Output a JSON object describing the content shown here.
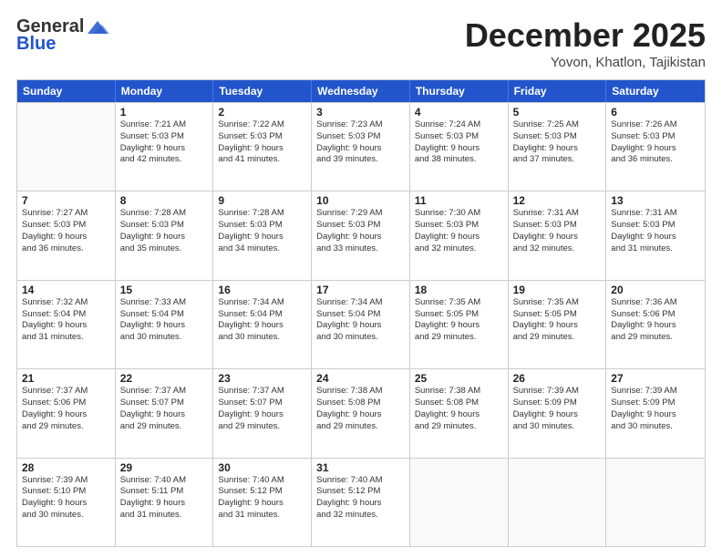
{
  "header": {
    "logo_general": "General",
    "logo_blue": "Blue",
    "month_title": "December 2025",
    "location": "Yovon, Khatlon, Tajikistan"
  },
  "weekdays": [
    "Sunday",
    "Monday",
    "Tuesday",
    "Wednesday",
    "Thursday",
    "Friday",
    "Saturday"
  ],
  "rows": [
    [
      {
        "day": "",
        "text": ""
      },
      {
        "day": "1",
        "text": "Sunrise: 7:21 AM\nSunset: 5:03 PM\nDaylight: 9 hours\nand 42 minutes."
      },
      {
        "day": "2",
        "text": "Sunrise: 7:22 AM\nSunset: 5:03 PM\nDaylight: 9 hours\nand 41 minutes."
      },
      {
        "day": "3",
        "text": "Sunrise: 7:23 AM\nSunset: 5:03 PM\nDaylight: 9 hours\nand 39 minutes."
      },
      {
        "day": "4",
        "text": "Sunrise: 7:24 AM\nSunset: 5:03 PM\nDaylight: 9 hours\nand 38 minutes."
      },
      {
        "day": "5",
        "text": "Sunrise: 7:25 AM\nSunset: 5:03 PM\nDaylight: 9 hours\nand 37 minutes."
      },
      {
        "day": "6",
        "text": "Sunrise: 7:26 AM\nSunset: 5:03 PM\nDaylight: 9 hours\nand 36 minutes."
      }
    ],
    [
      {
        "day": "7",
        "text": "Sunrise: 7:27 AM\nSunset: 5:03 PM\nDaylight: 9 hours\nand 36 minutes."
      },
      {
        "day": "8",
        "text": "Sunrise: 7:28 AM\nSunset: 5:03 PM\nDaylight: 9 hours\nand 35 minutes."
      },
      {
        "day": "9",
        "text": "Sunrise: 7:28 AM\nSunset: 5:03 PM\nDaylight: 9 hours\nand 34 minutes."
      },
      {
        "day": "10",
        "text": "Sunrise: 7:29 AM\nSunset: 5:03 PM\nDaylight: 9 hours\nand 33 minutes."
      },
      {
        "day": "11",
        "text": "Sunrise: 7:30 AM\nSunset: 5:03 PM\nDaylight: 9 hours\nand 32 minutes."
      },
      {
        "day": "12",
        "text": "Sunrise: 7:31 AM\nSunset: 5:03 PM\nDaylight: 9 hours\nand 32 minutes."
      },
      {
        "day": "13",
        "text": "Sunrise: 7:31 AM\nSunset: 5:03 PM\nDaylight: 9 hours\nand 31 minutes."
      }
    ],
    [
      {
        "day": "14",
        "text": "Sunrise: 7:32 AM\nSunset: 5:04 PM\nDaylight: 9 hours\nand 31 minutes."
      },
      {
        "day": "15",
        "text": "Sunrise: 7:33 AM\nSunset: 5:04 PM\nDaylight: 9 hours\nand 30 minutes."
      },
      {
        "day": "16",
        "text": "Sunrise: 7:34 AM\nSunset: 5:04 PM\nDaylight: 9 hours\nand 30 minutes."
      },
      {
        "day": "17",
        "text": "Sunrise: 7:34 AM\nSunset: 5:04 PM\nDaylight: 9 hours\nand 30 minutes."
      },
      {
        "day": "18",
        "text": "Sunrise: 7:35 AM\nSunset: 5:05 PM\nDaylight: 9 hours\nand 29 minutes."
      },
      {
        "day": "19",
        "text": "Sunrise: 7:35 AM\nSunset: 5:05 PM\nDaylight: 9 hours\nand 29 minutes."
      },
      {
        "day": "20",
        "text": "Sunrise: 7:36 AM\nSunset: 5:06 PM\nDaylight: 9 hours\nand 29 minutes."
      }
    ],
    [
      {
        "day": "21",
        "text": "Sunrise: 7:37 AM\nSunset: 5:06 PM\nDaylight: 9 hours\nand 29 minutes."
      },
      {
        "day": "22",
        "text": "Sunrise: 7:37 AM\nSunset: 5:07 PM\nDaylight: 9 hours\nand 29 minutes."
      },
      {
        "day": "23",
        "text": "Sunrise: 7:37 AM\nSunset: 5:07 PM\nDaylight: 9 hours\nand 29 minutes."
      },
      {
        "day": "24",
        "text": "Sunrise: 7:38 AM\nSunset: 5:08 PM\nDaylight: 9 hours\nand 29 minutes."
      },
      {
        "day": "25",
        "text": "Sunrise: 7:38 AM\nSunset: 5:08 PM\nDaylight: 9 hours\nand 29 minutes."
      },
      {
        "day": "26",
        "text": "Sunrise: 7:39 AM\nSunset: 5:09 PM\nDaylight: 9 hours\nand 30 minutes."
      },
      {
        "day": "27",
        "text": "Sunrise: 7:39 AM\nSunset: 5:09 PM\nDaylight: 9 hours\nand 30 minutes."
      }
    ],
    [
      {
        "day": "28",
        "text": "Sunrise: 7:39 AM\nSunset: 5:10 PM\nDaylight: 9 hours\nand 30 minutes."
      },
      {
        "day": "29",
        "text": "Sunrise: 7:40 AM\nSunset: 5:11 PM\nDaylight: 9 hours\nand 31 minutes."
      },
      {
        "day": "30",
        "text": "Sunrise: 7:40 AM\nSunset: 5:12 PM\nDaylight: 9 hours\nand 31 minutes."
      },
      {
        "day": "31",
        "text": "Sunrise: 7:40 AM\nSunset: 5:12 PM\nDaylight: 9 hours\nand 32 minutes."
      },
      {
        "day": "",
        "text": ""
      },
      {
        "day": "",
        "text": ""
      },
      {
        "day": "",
        "text": ""
      }
    ]
  ]
}
